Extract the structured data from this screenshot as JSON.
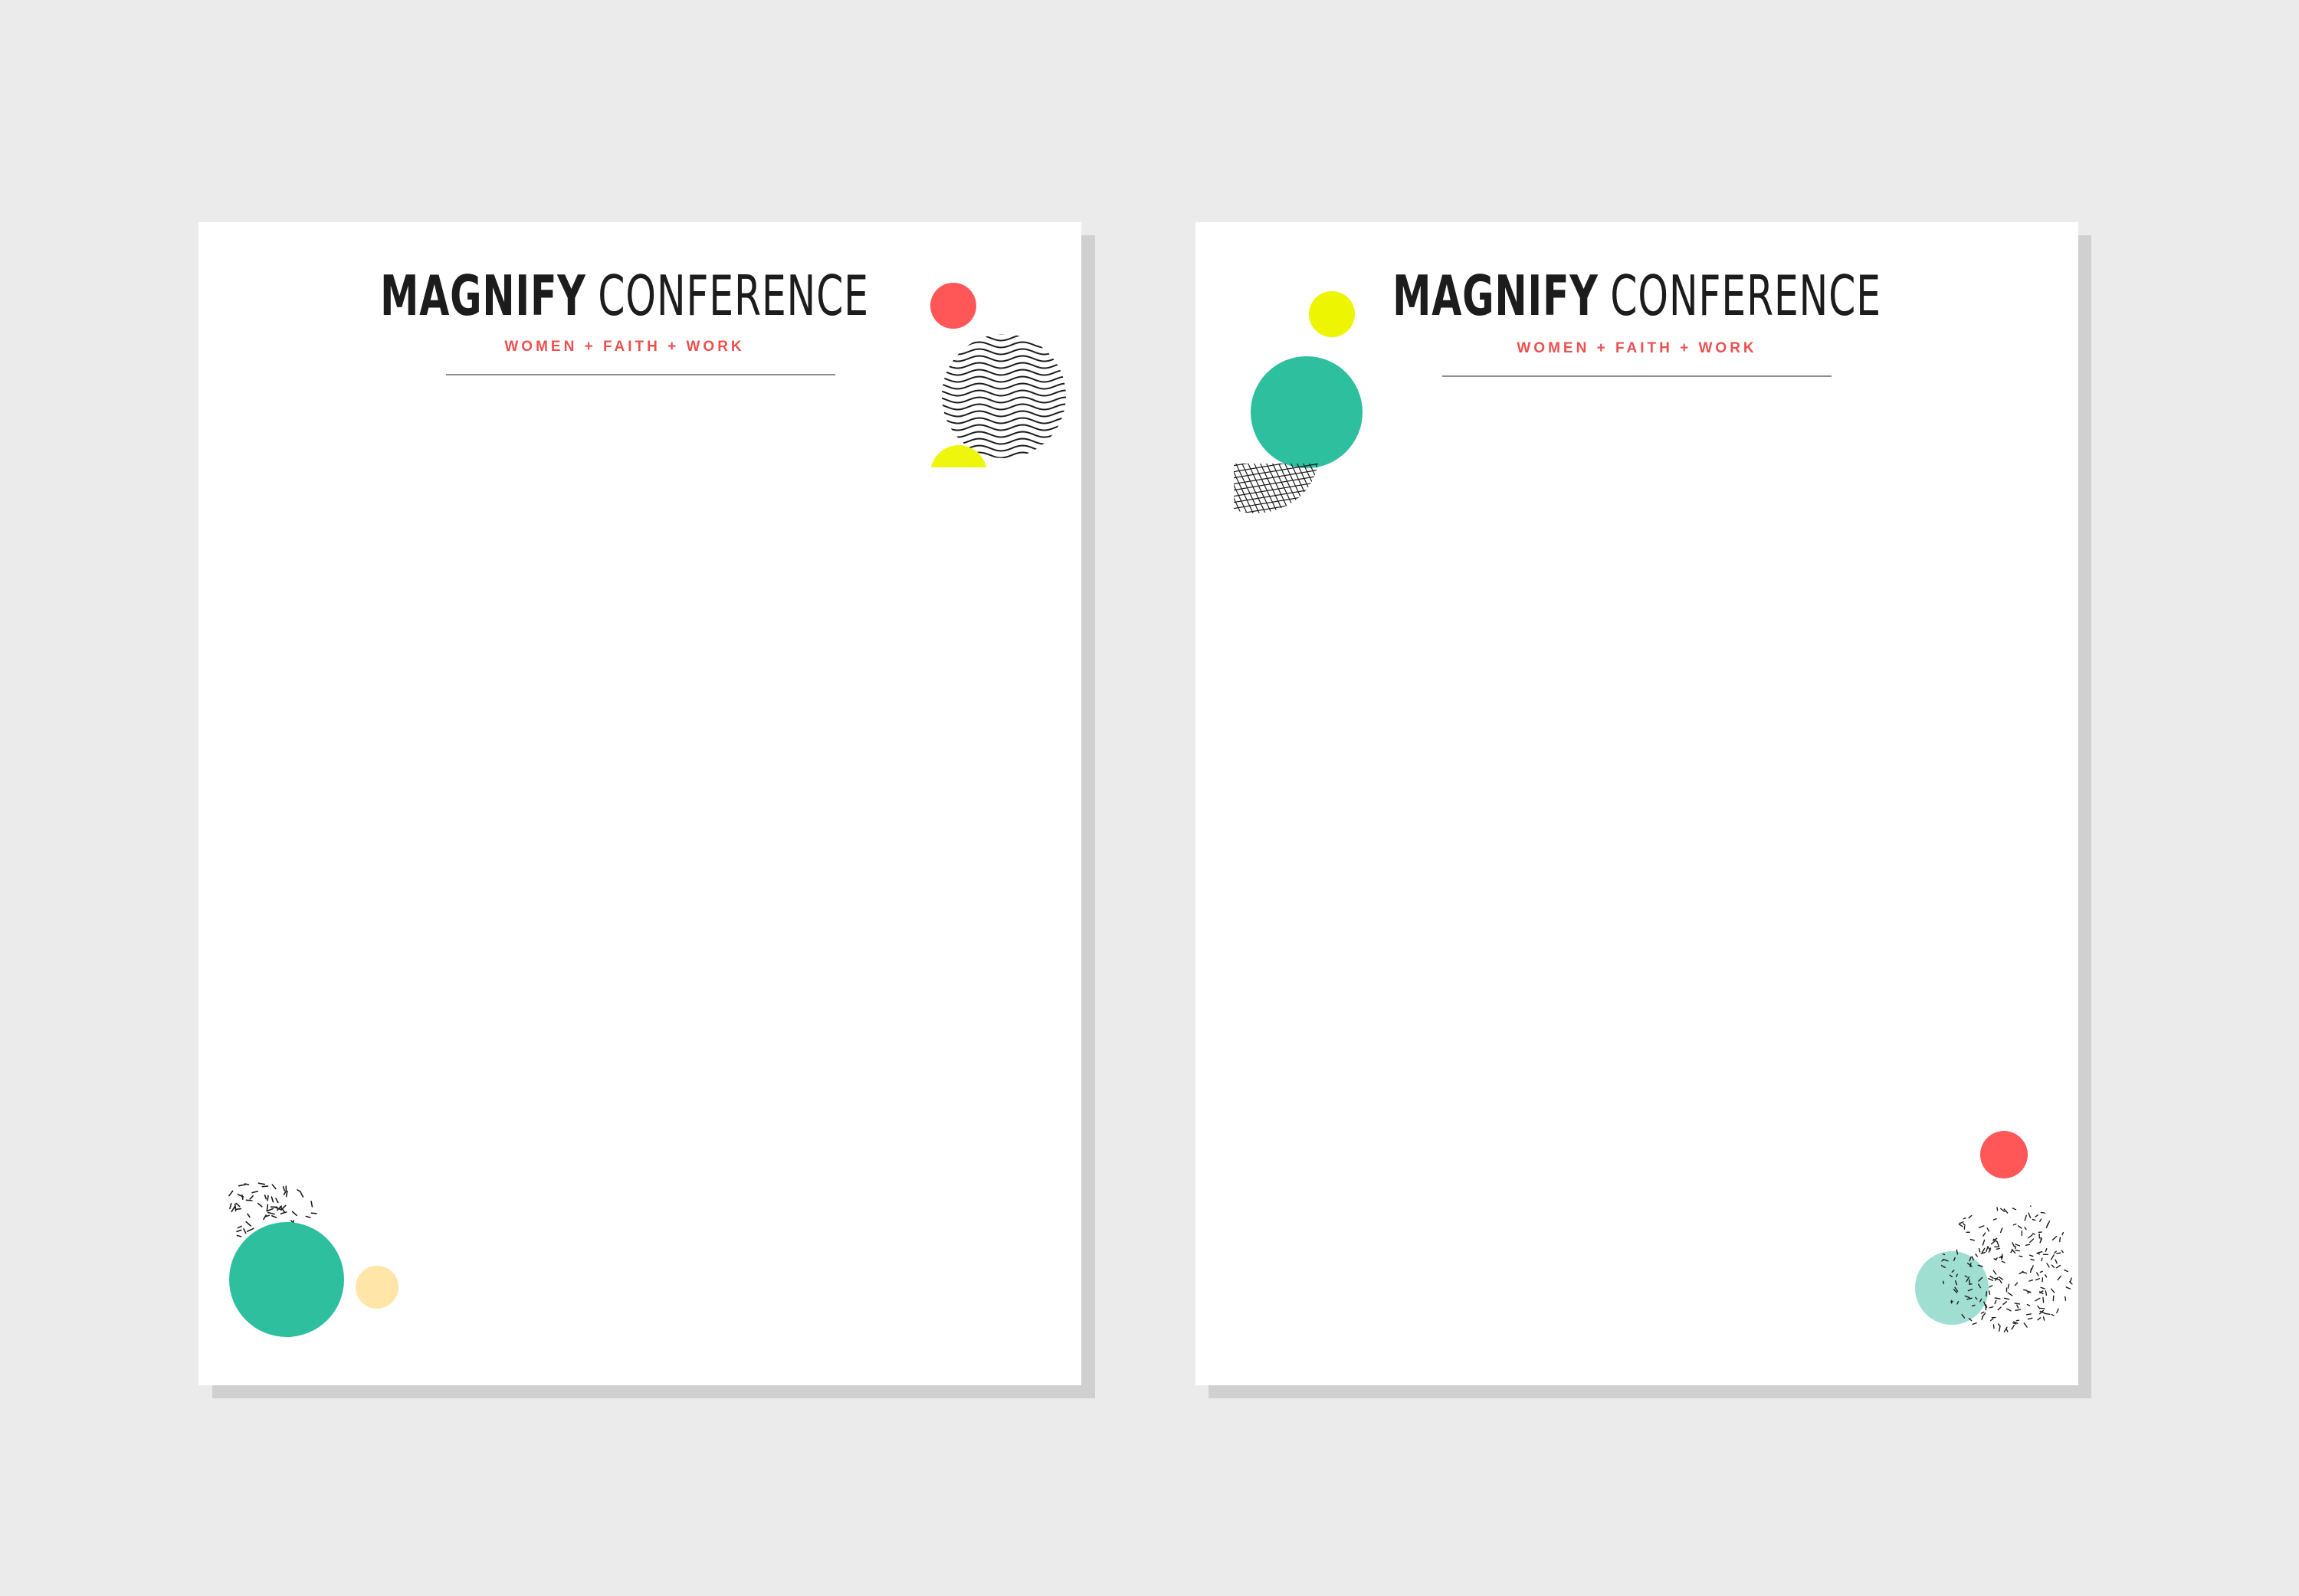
{
  "background_color": "#ebebeb",
  "shadow_color": "#d0d0d0",
  "sheets": [
    {
      "brand": "MAGNIFY",
      "event": "CONFERENCE",
      "tagline": "WOMEN + FAITH + WORK",
      "decorations": [
        "red-dot-icon",
        "wave-pattern-circle-icon",
        "yellow-dot-icon",
        "confetti-pattern-icon",
        "teal-circle-icon",
        "peach-dot-icon"
      ]
    },
    {
      "brand": "MAGNIFY",
      "event": "CONFERENCE",
      "tagline": "WOMEN + FAITH + WORK",
      "decorations": [
        "yellow-dot-icon",
        "teal-circle-icon",
        "grid-pattern-icon",
        "red-dot-icon",
        "speckle-pattern-circle-icon",
        "light-teal-circle-icon"
      ]
    }
  ],
  "colors": {
    "red": "#ff5757",
    "yellow": "#eef500",
    "teal": "#2ebf9f",
    "light_teal": "#9fded1",
    "peach": "#ffe6a8",
    "tagline": "#ef4f4f",
    "ink": "#1c1c1c"
  }
}
